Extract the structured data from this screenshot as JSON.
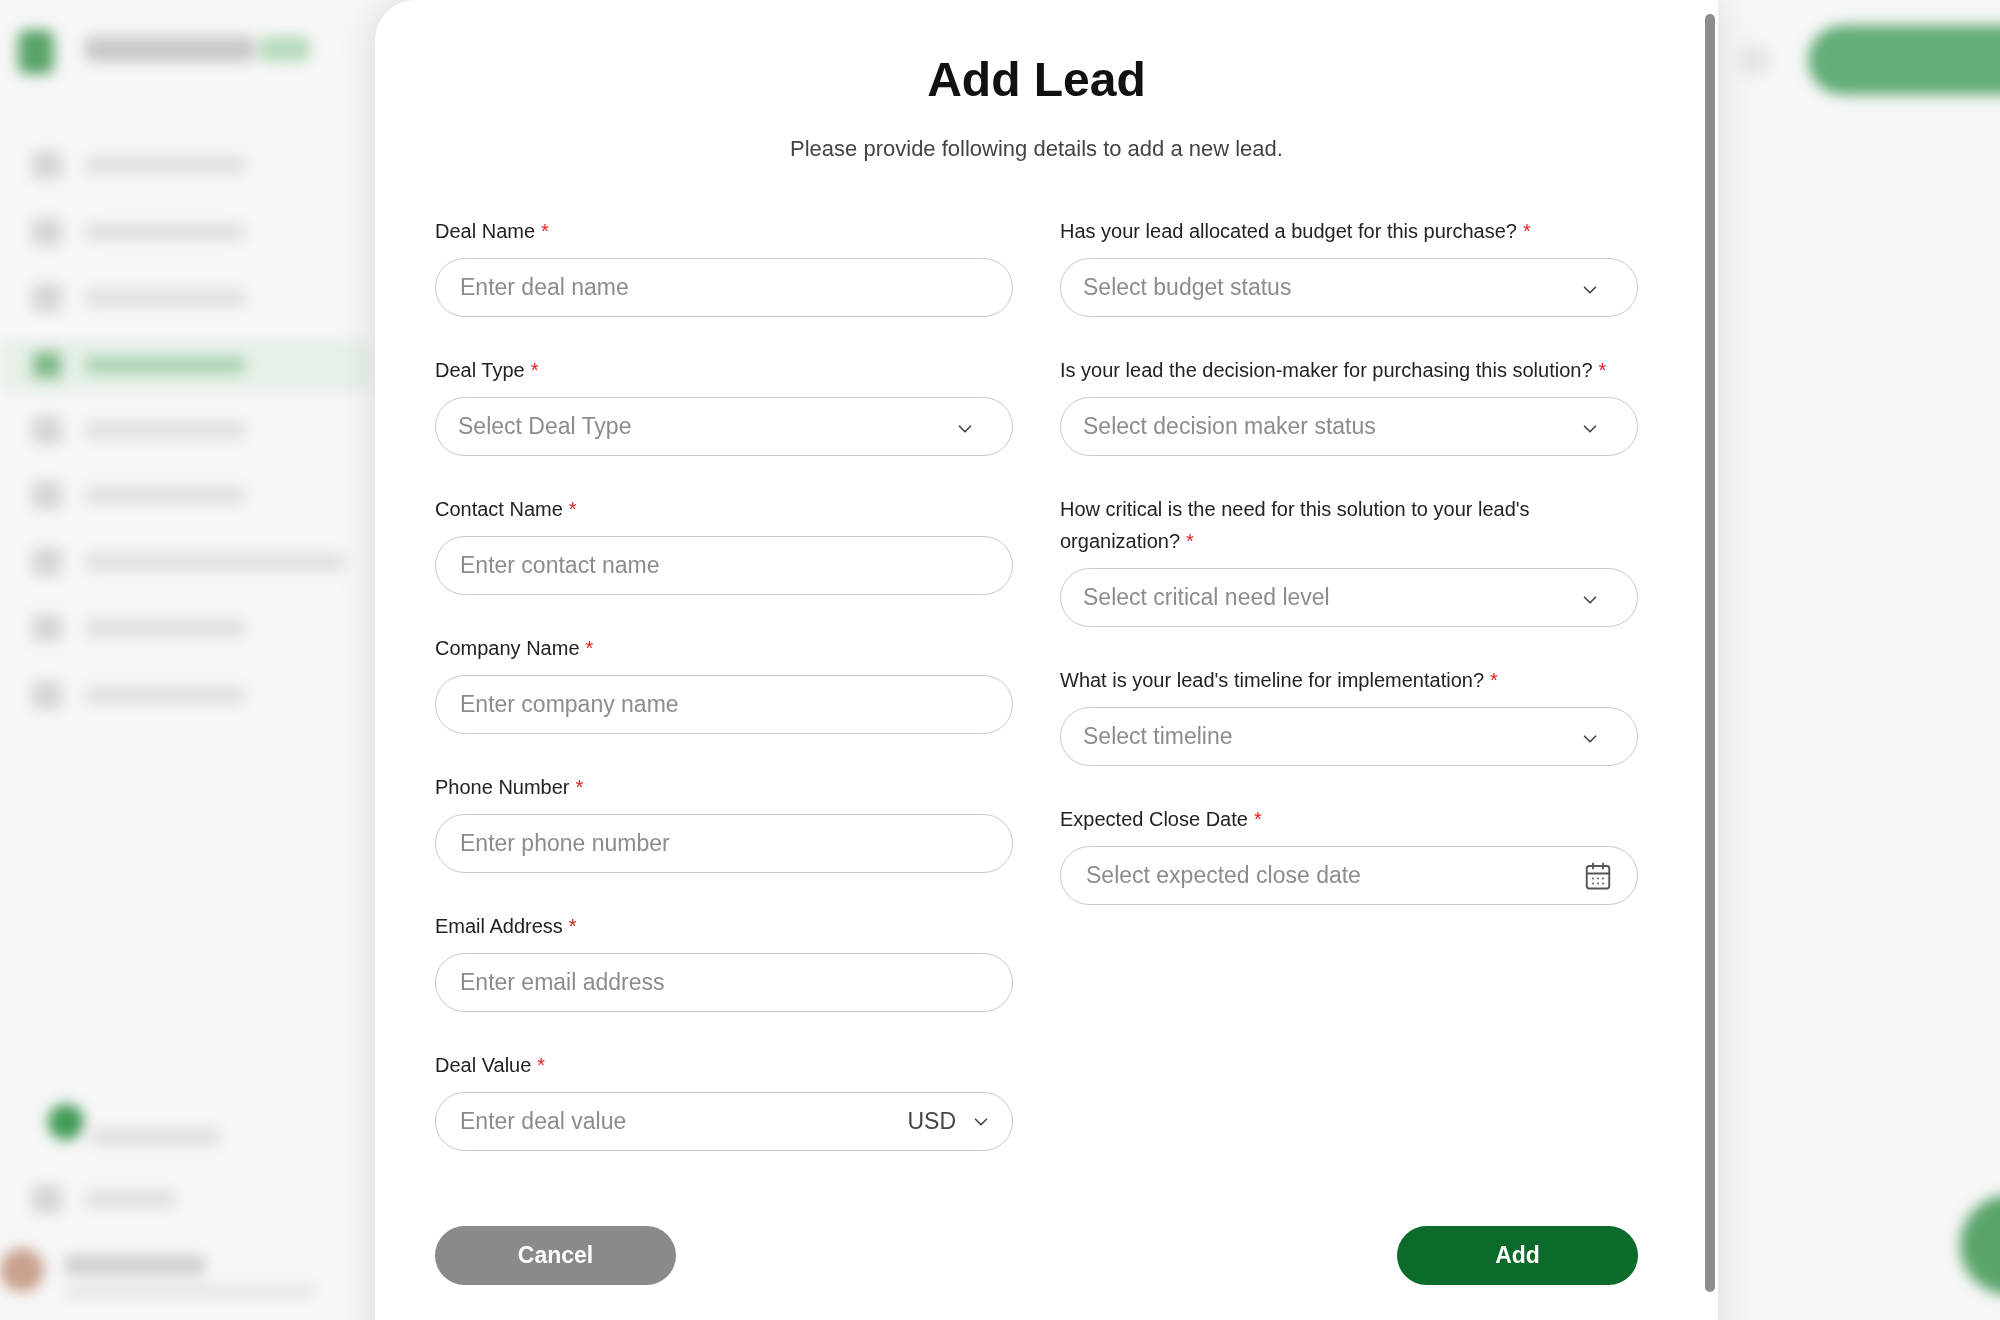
{
  "dialog": {
    "title": "Add Lead",
    "subtitle": "Please provide following details to add a new lead."
  },
  "left_fields": [
    {
      "kind": "text",
      "label": "Deal Name",
      "required": true,
      "required_mark": "*",
      "placeholder": "Enter deal name"
    },
    {
      "kind": "select",
      "label": "Deal Type",
      "required": true,
      "required_mark": "*",
      "placeholder": "Select Deal Type"
    },
    {
      "kind": "text",
      "label": "Contact Name",
      "required": true,
      "required_mark": "*",
      "placeholder": "Enter contact name"
    },
    {
      "kind": "text",
      "label": "Company Name",
      "required": true,
      "required_mark": "*",
      "placeholder": "Enter company name"
    },
    {
      "kind": "text",
      "label": "Phone Number",
      "required": true,
      "required_mark": "*",
      "placeholder": "Enter phone number"
    },
    {
      "kind": "text",
      "label": "Email Address",
      "required": true,
      "required_mark": "*",
      "placeholder": "Enter email address"
    },
    {
      "kind": "currency",
      "label": "Deal Value",
      "required": true,
      "required_mark": "*",
      "placeholder": "Enter deal value",
      "currency": "USD"
    }
  ],
  "right_fields": [
    {
      "kind": "select",
      "label": "Has your lead allocated a budget for this purchase?",
      "required": true,
      "required_mark": "*",
      "placeholder": "Select budget status"
    },
    {
      "kind": "select",
      "label": "Is your lead the decision-maker for purchasing this solution?",
      "required": true,
      "required_mark": "*",
      "placeholder": "Select decision maker status"
    },
    {
      "kind": "select",
      "label": "How critical is the need for this solution to your lead's organization?",
      "required": true,
      "required_mark": "*",
      "placeholder": "Select critical need level"
    },
    {
      "kind": "select",
      "label": "What is your lead's timeline for implementation?",
      "required": true,
      "required_mark": "*",
      "placeholder": "Select timeline"
    },
    {
      "kind": "date",
      "label": "Expected Close Date",
      "required": true,
      "required_mark": "*",
      "placeholder": "Select expected close date"
    }
  ],
  "buttons": {
    "cancel": "Cancel",
    "add": "Add"
  }
}
